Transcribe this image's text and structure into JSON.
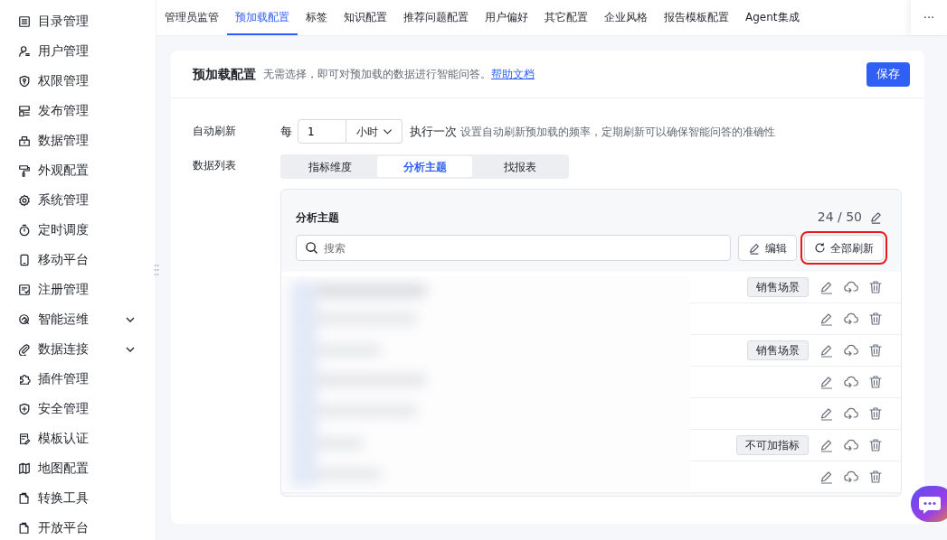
{
  "sidebar": {
    "items": [
      {
        "label": "目录管理",
        "expandable": false
      },
      {
        "label": "用户管理",
        "expandable": false
      },
      {
        "label": "权限管理",
        "expandable": false
      },
      {
        "label": "发布管理",
        "expandable": false
      },
      {
        "label": "数据管理",
        "expandable": false
      },
      {
        "label": "外观配置",
        "expandable": false
      },
      {
        "label": "系统管理",
        "expandable": false
      },
      {
        "label": "定时调度",
        "expandable": false
      },
      {
        "label": "移动平台",
        "expandable": false
      },
      {
        "label": "注册管理",
        "expandable": false
      },
      {
        "label": "智能运维",
        "expandable": true
      },
      {
        "label": "数据连接",
        "expandable": true
      },
      {
        "label": "插件管理",
        "expandable": false
      },
      {
        "label": "安全管理",
        "expandable": false
      },
      {
        "label": "模板认证",
        "expandable": false
      },
      {
        "label": "地图配置",
        "expandable": false
      },
      {
        "label": "转换工具",
        "expandable": false
      },
      {
        "label": "开放平台",
        "expandable": false
      }
    ]
  },
  "tabs": [
    {
      "label": "管理员监管",
      "selected": false
    },
    {
      "label": "预加载配置",
      "selected": true
    },
    {
      "label": "标签",
      "selected": false
    },
    {
      "label": "知识配置",
      "selected": false
    },
    {
      "label": "推荐问题配置",
      "selected": false
    },
    {
      "label": "用户偏好",
      "selected": false
    },
    {
      "label": "其它配置",
      "selected": false
    },
    {
      "label": "企业风格",
      "selected": false
    },
    {
      "label": "报告模板配置",
      "selected": false
    },
    {
      "label": "Agent集成",
      "selected": false
    }
  ],
  "tabs_more": "···",
  "panel": {
    "title": "预加载配置",
    "description": "无需选择，即可对预加载的数据进行智能问答。",
    "help_link": "帮助文档",
    "save_button": "保存"
  },
  "auto_refresh": {
    "label": "自动刷新",
    "prefix": "每",
    "value": "1",
    "unit": "小时",
    "suffix": "执行一次",
    "hint": "设置自动刷新预加载的频率，定期刷新可以确保智能问答的准确性"
  },
  "data_list": {
    "label": "数据列表",
    "segments": [
      {
        "label": "指标维度",
        "selected": false
      },
      {
        "label": "分析主题",
        "selected": true
      },
      {
        "label": "找报表",
        "selected": false
      }
    ],
    "title": "分析主题",
    "count": "24 / 50",
    "search": {
      "placeholder": "搜索"
    },
    "edit_button": "编辑",
    "refresh_all_button": "全部刷新",
    "refresh_highlighted": true,
    "rows": [
      {
        "tag": "销售场景"
      },
      {},
      {
        "tag": "销售场景"
      },
      {},
      {},
      {
        "tag": "不可加指标"
      },
      {}
    ]
  }
}
